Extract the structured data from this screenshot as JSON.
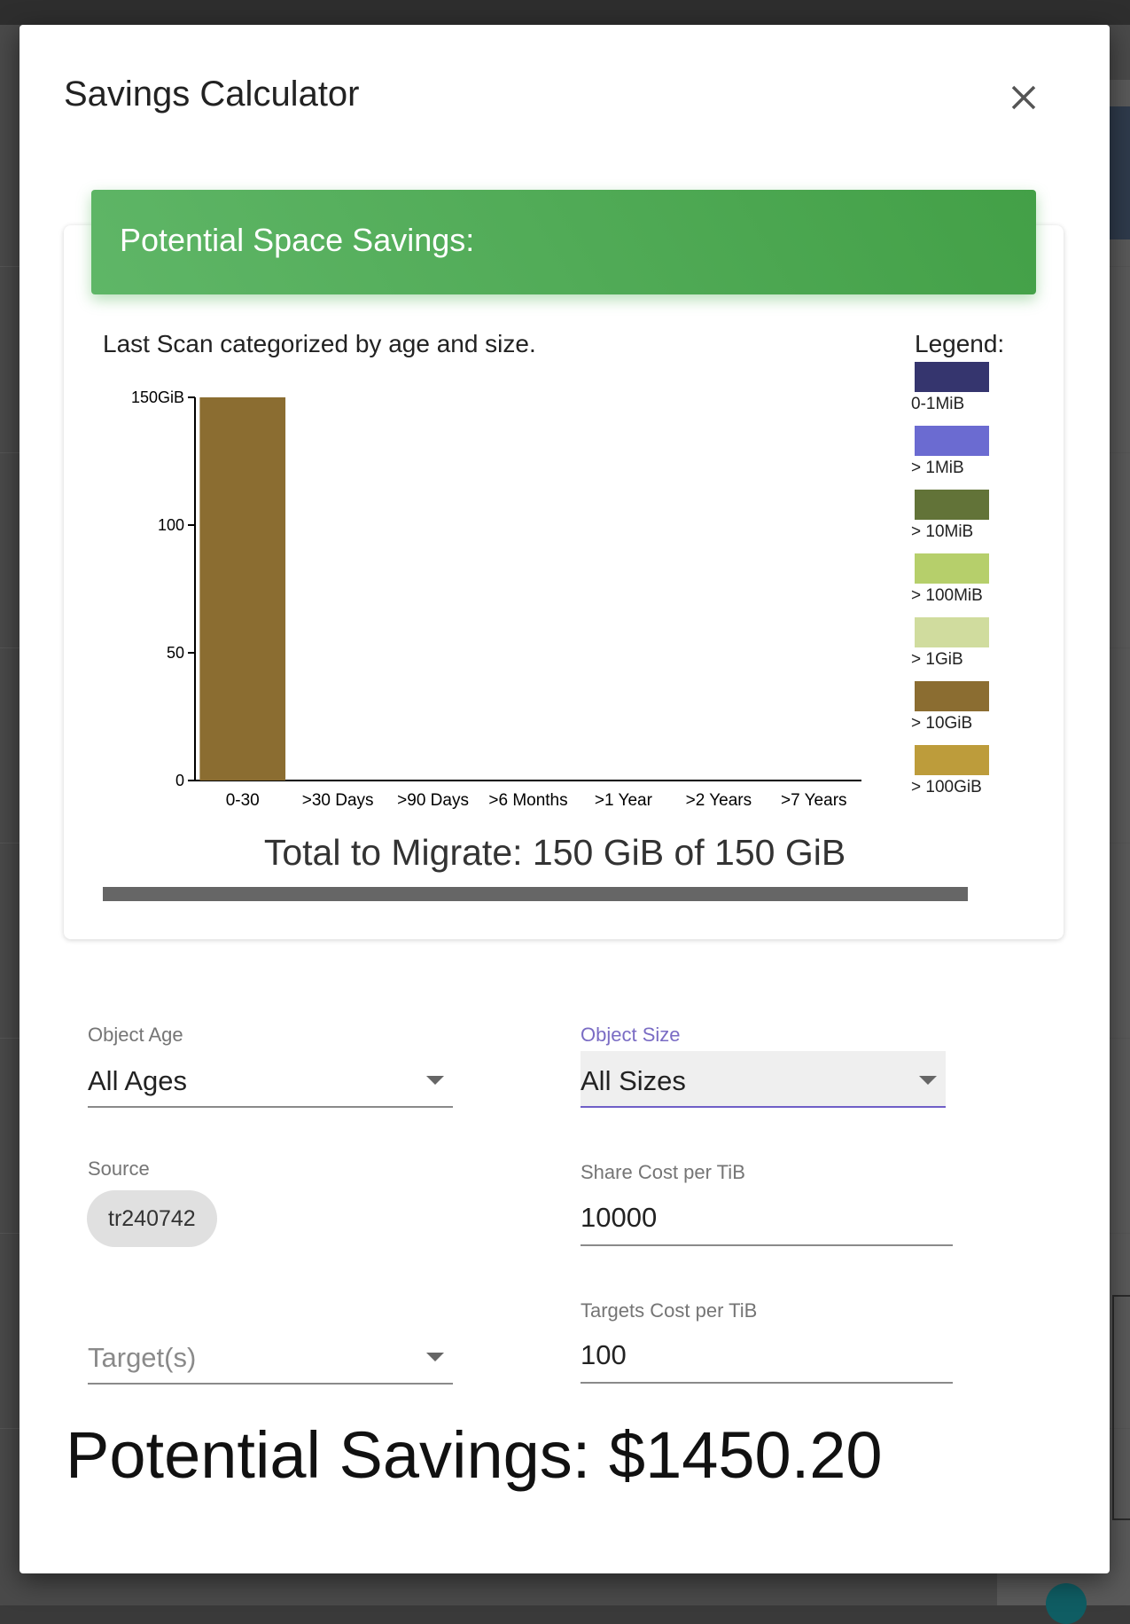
{
  "modal": {
    "title": "Savings Calculator"
  },
  "card": {
    "header": "Potential Space Savings:",
    "caption": "Last Scan categorized by age and size.",
    "legend_title": "Legend:",
    "legend": [
      {
        "label": "0-1MiB",
        "color": "#35356e"
      },
      {
        "label": "> 1MiB",
        "color": "#6b6bd1"
      },
      {
        "label": "> 10MiB",
        "color": "#627338"
      },
      {
        "label": "> 100MiB",
        "color": "#b6cf6b"
      },
      {
        "label": "> 1GiB",
        "color": "#d0dc9e"
      },
      {
        "label": "> 10GiB",
        "color": "#8b6d31"
      },
      {
        "label": "> 100GiB",
        "color": "#bd9c3b"
      }
    ],
    "total_text": "Total to Migrate: 150 GiB of 150 GiB",
    "progress_percent": 100
  },
  "chart_data": {
    "type": "bar",
    "categories": [
      "0-30",
      ">30 Days",
      ">90 Days",
      ">6 Months",
      ">1 Year",
      ">2 Years",
      ">7 Years"
    ],
    "series": [
      {
        "name": "> 10GiB",
        "values": [
          150,
          0,
          0,
          0,
          0,
          0,
          0
        ],
        "color": "#8b6d31"
      }
    ],
    "yticks": [
      {
        "value": 0,
        "label": "0"
      },
      {
        "value": 50,
        "label": "50"
      },
      {
        "value": 100,
        "label": "100"
      },
      {
        "value": 150,
        "label": "150GiB"
      }
    ],
    "ylim": [
      0,
      150
    ],
    "stacked": true,
    "grid": false,
    "legend_position": "right"
  },
  "form": {
    "object_age": {
      "label": "Object Age",
      "value": "All Ages"
    },
    "object_size": {
      "label": "Object Size",
      "value": "All Sizes"
    },
    "source": {
      "label": "Source",
      "chip": "tr240742"
    },
    "targets": {
      "placeholder": "Target(s)"
    },
    "share_cost": {
      "label": "Share Cost per TiB",
      "value": "10000"
    },
    "targets_cost": {
      "label": "Targets Cost per TiB",
      "value": "100"
    }
  },
  "savings": {
    "text": "Potential Savings: $1450.20"
  },
  "colors": {
    "header_green": "#4caf50",
    "active_purple": "#7a6cc4"
  }
}
